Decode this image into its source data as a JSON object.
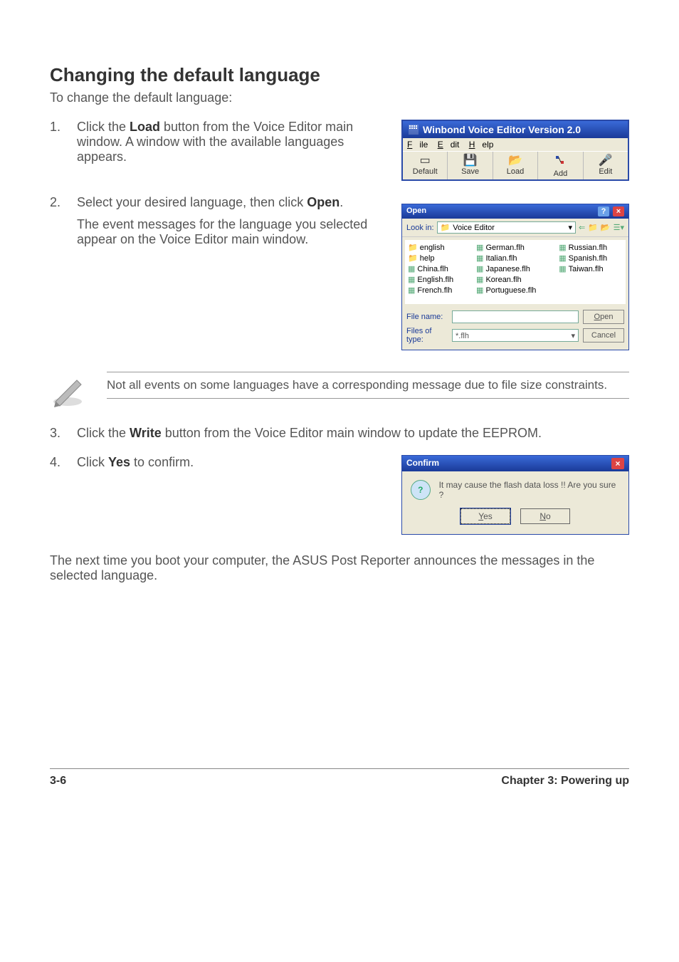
{
  "title": "Changing the default language",
  "intro": "To change the default language:",
  "steps": {
    "1": {
      "num": "1.",
      "text_a": "Click the ",
      "bold_a": "Load",
      "text_b": " button from the Voice Editor main window. A window with the available languages appears."
    },
    "2": {
      "num": "2.",
      "text_a": "Select your desired language, then click ",
      "bold_a": "Open",
      "text_b": ".",
      "para2": "The event messages for the language you selected appear on the Voice Editor main window."
    },
    "3": {
      "num": "3.",
      "text_a": "Click the ",
      "bold_a": "Write",
      "text_b": " button from the Voice Editor main window to update the EEPROM."
    },
    "4": {
      "num": "4.",
      "text_a": "Click ",
      "bold_a": "Yes",
      "text_b": " to confirm."
    }
  },
  "note": "Not all events on some languages have a corresponding message due to file size constraints.",
  "closing": "The next time you boot your computer, the ASUS Post Reporter announces the messages in the selected language.",
  "winbond": {
    "title": "Winbond Voice Editor  Version 2.0",
    "menu": {
      "file": "File",
      "edit": "Edit",
      "help": "Help"
    },
    "buttons": {
      "default": "Default",
      "save": "Save",
      "load": "Load",
      "add": "Add",
      "edit": "Edit"
    }
  },
  "open_dialog": {
    "title": "Open",
    "look_in_label": "Look in:",
    "look_in_value": "Voice Editor",
    "files": [
      {
        "name": "english",
        "type": "folder"
      },
      {
        "name": "help",
        "type": "folder"
      },
      {
        "name": "China.flh",
        "type": "file"
      },
      {
        "name": "English.flh",
        "type": "file"
      },
      {
        "name": "French.flh",
        "type": "file"
      },
      {
        "name": "German.flh",
        "type": "file"
      },
      {
        "name": "Italian.flh",
        "type": "file"
      },
      {
        "name": "Japanese.flh",
        "type": "file"
      },
      {
        "name": "Korean.flh",
        "type": "file"
      },
      {
        "name": "Portuguese.flh",
        "type": "file"
      },
      {
        "name": "Russian.flh",
        "type": "file"
      },
      {
        "name": "Spanish.flh",
        "type": "file"
      },
      {
        "name": "Taiwan.flh",
        "type": "file"
      }
    ],
    "file_name_label": "File name:",
    "file_name_value": "",
    "files_of_type_label": "Files of type:",
    "files_of_type_value": "*.flh",
    "open_btn": "Open",
    "cancel_btn": "Cancel"
  },
  "confirm_dialog": {
    "title": "Confirm",
    "message": "It may cause the flash data loss !!  Are you sure ?",
    "yes": "Yes",
    "no": "No"
  },
  "footer": {
    "page": "3-6",
    "chapter": "Chapter 3: Powering up"
  }
}
